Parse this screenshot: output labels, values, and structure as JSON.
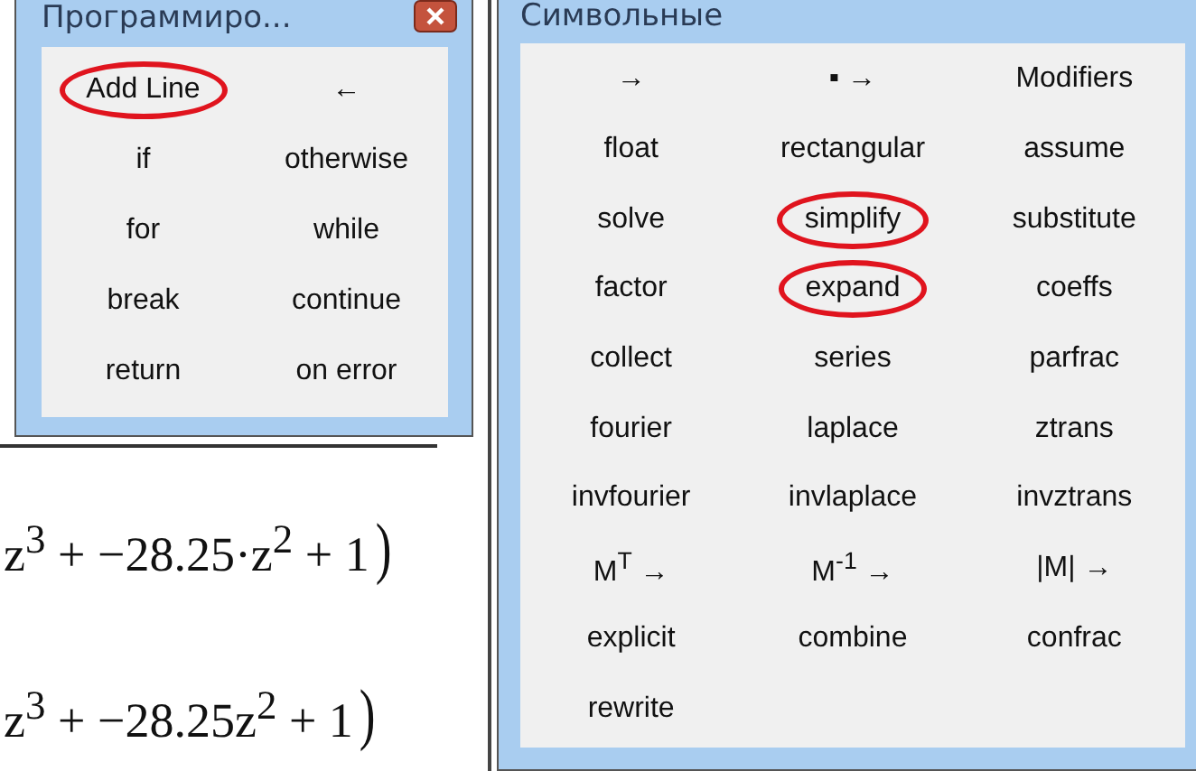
{
  "programming_toolbar": {
    "title": "Программиро...",
    "buttons": [
      {
        "label": "Add Line",
        "highlighted": true
      },
      {
        "label": "←",
        "highlighted": false
      },
      {
        "label": "if",
        "highlighted": false
      },
      {
        "label": "otherwise",
        "highlighted": false
      },
      {
        "label": "for",
        "highlighted": false
      },
      {
        "label": "while",
        "highlighted": false
      },
      {
        "label": "break",
        "highlighted": false
      },
      {
        "label": "continue",
        "highlighted": false
      },
      {
        "label": "return",
        "highlighted": false
      },
      {
        "label": "on error",
        "highlighted": false
      }
    ]
  },
  "worksheet": {
    "expressions": [
      "z$^{3}$ + −28.25·z$^{2}$ + 1",
      "z$^{3}$ + −28.25z$^{2}$ + 1"
    ],
    "closing_paren": ")"
  },
  "symbolic_toolbar": {
    "title": "Символьные",
    "buttons": [
      {
        "label": "→",
        "highlighted": false
      },
      {
        "label": "▪ →",
        "highlighted": false
      },
      {
        "label": "Modifiers",
        "highlighted": false
      },
      {
        "label": "float",
        "highlighted": false
      },
      {
        "label": "rectangular",
        "highlighted": false
      },
      {
        "label": "assume",
        "highlighted": false
      },
      {
        "label": "solve",
        "highlighted": false
      },
      {
        "label": "simplify",
        "highlighted": true
      },
      {
        "label": "substitute",
        "highlighted": false
      },
      {
        "label": "factor",
        "highlighted": false
      },
      {
        "label": "expand",
        "highlighted": true
      },
      {
        "label": "coeffs",
        "highlighted": false
      },
      {
        "label": "collect",
        "highlighted": false
      },
      {
        "label": "series",
        "highlighted": false
      },
      {
        "label": "parfrac",
        "highlighted": false
      },
      {
        "label": "fourier",
        "highlighted": false
      },
      {
        "label": "laplace",
        "highlighted": false
      },
      {
        "label": "ztrans",
        "highlighted": false
      },
      {
        "label": "invfourier",
        "highlighted": false
      },
      {
        "label": "invlaplace",
        "highlighted": false
      },
      {
        "label": "invztrans",
        "highlighted": false
      },
      {
        "label": "M$^{T}$ →",
        "highlighted": false
      },
      {
        "label": "M$^{-1}$ →",
        "highlighted": false
      },
      {
        "label": "|M| →",
        "highlighted": false
      },
      {
        "label": "explicit",
        "highlighted": false
      },
      {
        "label": "combine",
        "highlighted": false
      },
      {
        "label": "confrac",
        "highlighted": false
      },
      {
        "label": "rewrite",
        "highlighted": false
      }
    ]
  }
}
